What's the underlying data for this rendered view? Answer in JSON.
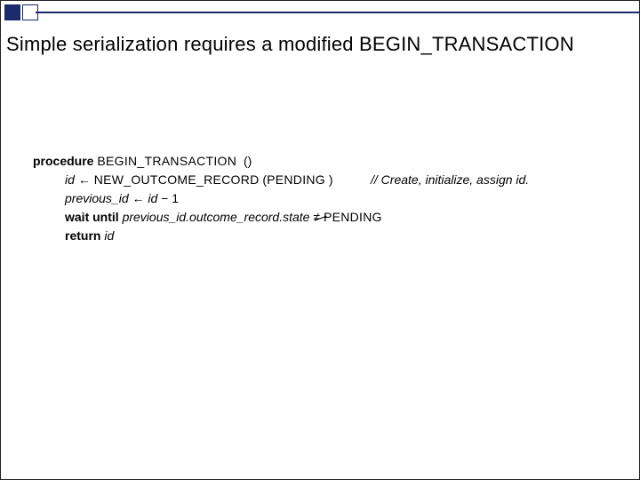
{
  "title": "Simple serialization requires a modified BEGIN_TRANSACTION",
  "code": {
    "kw_procedure": "procedure",
    "proc_name": "BEGIN_TRANSACTION",
    "parens": "()",
    "l1_id": "id",
    "l1_arrow": "←",
    "l1_call": "NEW_OUTCOME_RECORD",
    "l1_arg": "PENDING",
    "l1_comment": "// Create, initialize, assign id.",
    "l2_prev": "previous_id",
    "l2_arrow": "←",
    "l2_id": "id",
    "l2_rest": " − 1",
    "l3_wait": "wait until",
    "l3_expr": "previous_id.outcome_record.state",
    "l3_neq": "≠",
    "l3_pending": "PENDING",
    "l4_return": "return",
    "l4_id": "id"
  }
}
